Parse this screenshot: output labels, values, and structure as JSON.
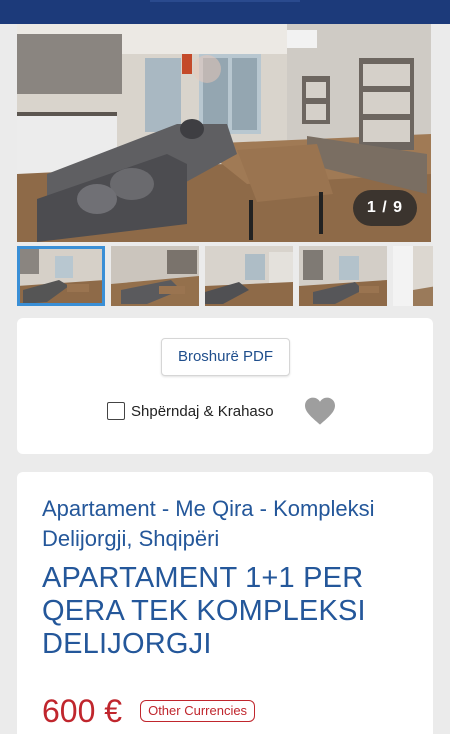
{
  "gallery": {
    "counter": "1 / 9",
    "thumbnail_count": 5
  },
  "actions": {
    "pdf_button": "Broshurë PDF",
    "share_compare_label": "Shpërndaj & Krahaso",
    "favorite_icon": "heart-icon"
  },
  "listing": {
    "subtitle": "Apartament - Me Qira - Kompleksi Delijorgji, Shqipëri",
    "title": "APARTAMENT 1+1 PER QERA TEK KOMPLEKSI DELIJORGJI",
    "price": "600 €",
    "other_currencies": "Other Currencies"
  },
  "colors": {
    "header": "#1c3a7a",
    "link_blue": "#24579a",
    "price_red": "#c0262d",
    "active_thumb": "#3a8fd6"
  }
}
